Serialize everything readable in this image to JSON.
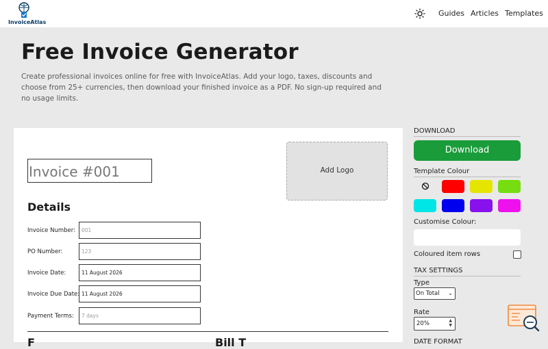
{
  "header": {
    "brand": "InvoiceAtlas",
    "theme_icon": "sun-icon",
    "nav": [
      {
        "label": "Guides"
      },
      {
        "label": "Articles"
      },
      {
        "label": "Templates"
      }
    ]
  },
  "hero": {
    "title": "Free Invoice Generator",
    "description": "Create professional invoices online for free with InvoiceAtlas. Add your logo, taxes, discounts and choose from 25+ currencies, then download your finished invoice as a PDF. No sign-up required and no usage limits."
  },
  "invoice": {
    "title_placeholder": "Invoice #001",
    "add_logo_label": "Add Logo",
    "details_heading": "Details",
    "fields": [
      {
        "label": "Invoice Number:",
        "value": "",
        "placeholder": "001"
      },
      {
        "label": "PO Number:",
        "value": "",
        "placeholder": "123"
      },
      {
        "label": "Invoice Date:",
        "value": "11 August 2026",
        "placeholder": ""
      },
      {
        "label": "Invoice Due Date:",
        "value": "11 August 2026",
        "placeholder": ""
      },
      {
        "label": "Payment Terms:",
        "value": "",
        "placeholder": "7 days"
      }
    ],
    "from_heading": "F",
    "bill_to_heading": "Bill T"
  },
  "sidebar": {
    "download_heading": "DOWNLOAD",
    "download_button": "Download",
    "template_colour_heading": "Template Colour",
    "colours": [
      {
        "name": "none",
        "hex": ""
      },
      {
        "name": "red",
        "hex": "#ff0000"
      },
      {
        "name": "yellow",
        "hex": "#e5e500"
      },
      {
        "name": "lime",
        "hex": "#77dd11"
      },
      {
        "name": "cyan",
        "hex": "#00e5e5"
      },
      {
        "name": "blue",
        "hex": "#0000ee"
      },
      {
        "name": "purple",
        "hex": "#8811ee"
      },
      {
        "name": "magenta",
        "hex": "#ee11ee"
      }
    ],
    "customise_colour_label": "Customise Colour:",
    "coloured_rows_label": "Coloured item rows",
    "coloured_rows_checked": false,
    "tax_heading": "TAX SETTINGS",
    "type_label": "Type",
    "type_value": "On Total",
    "rate_label": "Rate",
    "rate_value": "20%",
    "date_format_heading": "DATE FORMAT"
  },
  "colors": {
    "download_green": "#1a9c3a",
    "brand_navy": "#0b3d66"
  }
}
